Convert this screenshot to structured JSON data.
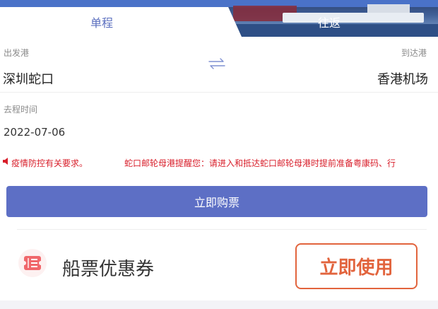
{
  "tabs": [
    {
      "label": "单程",
      "active": true
    },
    {
      "label": "往返",
      "active": false
    }
  ],
  "departure": {
    "label": "出发港",
    "value": "深圳蛇口"
  },
  "arrival": {
    "label": "到达港",
    "value": "香港机场"
  },
  "swap_icon": "swap-arrows-icon",
  "outbound": {
    "label": "去程时间",
    "value": "2022-07-06"
  },
  "notice": {
    "icon": "speaker-icon",
    "text1": "疫情防控有关要求。",
    "text2": "蛇口邮轮母港提醒您：请进入和抵达蛇口邮轮母港时提前准备粤康码、行"
  },
  "buy_button": "立即购票",
  "coupon": {
    "icon": "ticket-icon",
    "title": "船票优惠券",
    "use_button": "立即使用"
  },
  "colors": {
    "accent": "#5d6fc5",
    "notice": "#d81e2a",
    "coupon_btn": "#e2643d"
  }
}
